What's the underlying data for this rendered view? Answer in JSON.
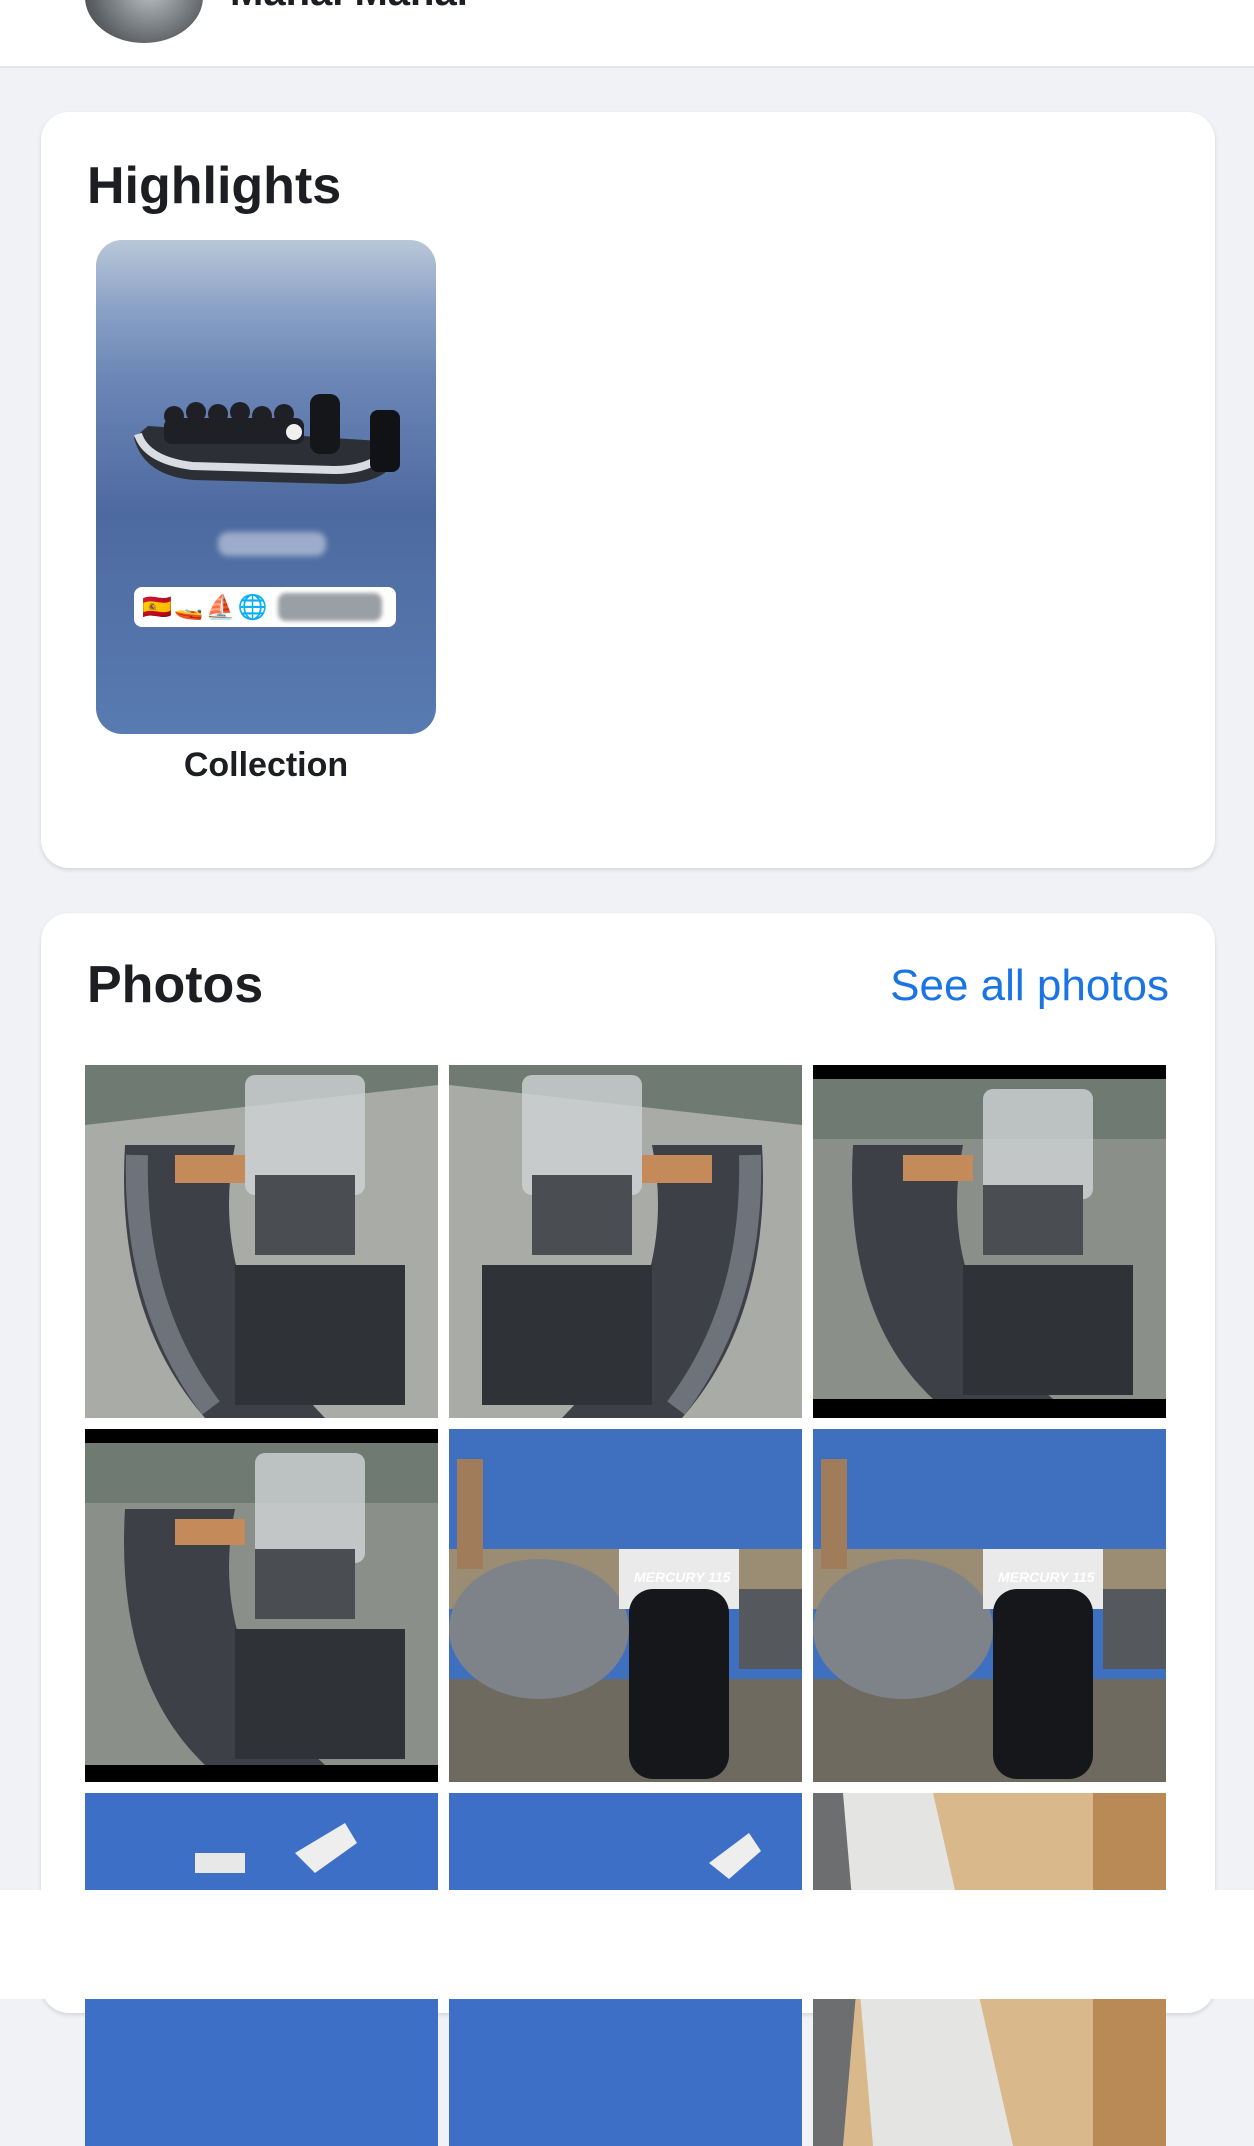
{
  "profile": {
    "name": "Manal Manal"
  },
  "highlights": {
    "title": "Highlights",
    "items": [
      {
        "label": "Collection",
        "sticker_emoji": "🇪🇸🚤⛵🌐"
      }
    ]
  },
  "photos": {
    "title": "Photos",
    "see_all_label": "See all photos",
    "tiles": [
      {
        "kind": "rib-cockpit",
        "mirror": false
      },
      {
        "kind": "rib-cockpit",
        "mirror": true
      },
      {
        "kind": "rib-cockpit",
        "mirror": false
      },
      {
        "kind": "rib-cockpit",
        "mirror": false
      },
      {
        "kind": "rib-outboard",
        "motor_text": "MERCURY 115"
      },
      {
        "kind": "rib-outboard",
        "motor_text": "MERCURY 115"
      },
      {
        "kind": "rib-sky"
      },
      {
        "kind": "rib-sky"
      },
      {
        "kind": "rib-hull"
      }
    ]
  },
  "colors": {
    "accent": "#1b74e4",
    "background": "#f0f2f5",
    "card": "#ffffff",
    "text": "#1c1e21"
  }
}
